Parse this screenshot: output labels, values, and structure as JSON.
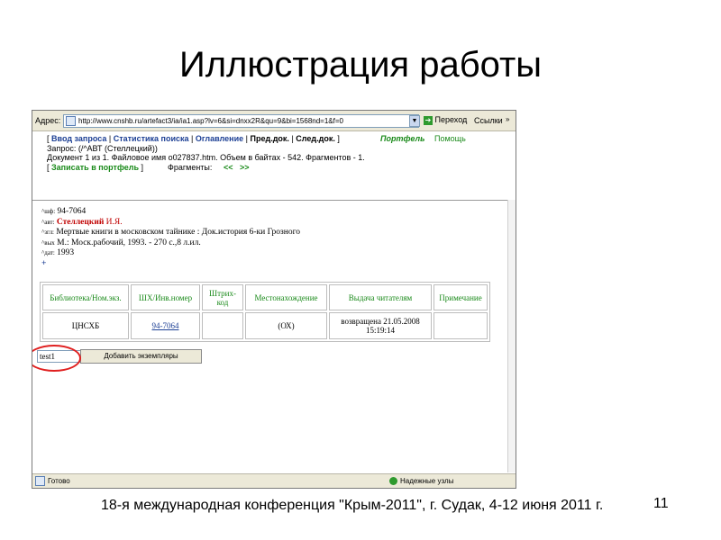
{
  "slide": {
    "title": "Иллюстрация работы",
    "footer": "18-я международная конференция \"Крым-2011\", г. Судак, 4-12 июня 2011 г.",
    "page_number": "11"
  },
  "browser": {
    "address_label": "Адрес:",
    "url": "http://www.cnshb.ru/artefact3/ia/ia1.asp?lv=6&si=dnxx2R&qu=9&bi=1568nd=1&f=0",
    "go_label": "Переход",
    "links_label": "Ссылки",
    "links_chevron": "»",
    "status_done": "Готово",
    "status_zone": "Надежные узлы"
  },
  "nav": {
    "bracket_open": "[",
    "bracket_close": "]",
    "sep": "|",
    "query_input": "Ввод запроса",
    "search_stats": "Статистика поиска",
    "contents": "Оглавление",
    "prev_doc": "Пред.док.",
    "next_doc": "След.док.",
    "portfolio": "Портфель",
    "help": "Помощь",
    "query_text": "Запрос: (/^АВТ (Стеллецкий))",
    "doc_info": "Документ 1 из 1. Файловое имя o027837.htm. Объем в байтах - 542. Фрагментов - 1.",
    "save_to_portfolio": "Записать в портфель",
    "fragments_label": "Фрагменты:",
    "frag_prev": "<<",
    "frag_next": ">>"
  },
  "record": {
    "shf_tag": "^шф:",
    "shf_value": "94-7064",
    "avt_tag": "^авт:",
    "avt_surname": "Стеллецкий",
    "avt_initials": "И.Я.",
    "zgl_tag": "^згл:",
    "zgl_value": "Мертвые книги в московском тайнике : Док.история 6-ки Грозного",
    "vyh_tag": "^вых",
    "vyh_value": "М.: Моск.рабочий, 1993. - 270 с.,8 л.ил.",
    "dat_tag": "^дат:",
    "dat_value": "1993",
    "plus": "+"
  },
  "holdings": {
    "headers": [
      "Библиотека/Ном.экз.",
      "ШХ/Инв.номер",
      "Штрих-код",
      "Местонахождение",
      "Выдача читателям",
      "Примечание"
    ],
    "row": [
      "ЦНСХБ",
      "94-7064",
      "",
      "(ОХ)",
      "возвращена 21.05.2008 15:19:14",
      ""
    ]
  },
  "form": {
    "input_value": "test1",
    "add_button": "Добавить экземпляры"
  }
}
